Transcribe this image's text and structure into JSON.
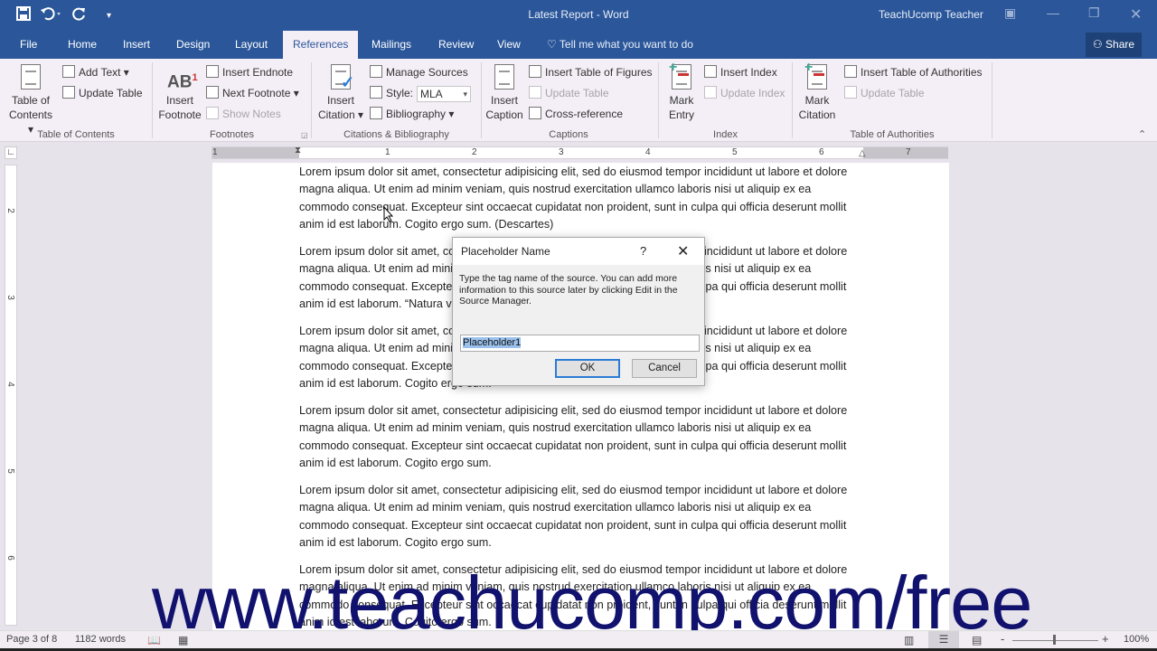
{
  "window": {
    "title": "Latest Report - Word",
    "user": "TeachUcomp Teacher",
    "qat": {
      "save_icon": "save-icon",
      "undo_icon": "undo-icon",
      "redo_icon": "redo-icon",
      "customize_icon": "customize-qat-icon"
    }
  },
  "tabs": [
    "File",
    "Home",
    "Insert",
    "Design",
    "Layout",
    "References",
    "Mailings",
    "Review",
    "View"
  ],
  "active_tab": "References",
  "tell_me": "Tell me what you want to do",
  "share_label": "Share",
  "ribbon": {
    "toc": {
      "label": "Table of Contents",
      "big": "Table of Contents",
      "big_l1": "Table of",
      "big_l2": "Contents ▾",
      "add_text": "Add Text ▾",
      "update_table": "Update Table"
    },
    "footnotes": {
      "label": "Footnotes",
      "insert_footnote_l1": "Insert",
      "insert_footnote_l2": "Footnote",
      "insert_endnote": "Insert Endnote",
      "next_footnote": "Next Footnote ▾",
      "show_notes": "Show Notes"
    },
    "citations": {
      "label": "Citations & Bibliography",
      "insert_citation_l1": "Insert",
      "insert_citation_l2": "Citation ▾",
      "manage_sources": "Manage Sources",
      "style_label": "Style:",
      "style_value": "MLA",
      "bibliography": "Bibliography ▾"
    },
    "captions": {
      "label": "Captions",
      "insert_caption_l1": "Insert",
      "insert_caption_l2": "Caption",
      "insert_table_of_figures": "Insert Table of Figures",
      "update_table": "Update Table",
      "cross_reference": "Cross-reference"
    },
    "index": {
      "label": "Index",
      "mark_entry_l1": "Mark",
      "mark_entry_l2": "Entry",
      "insert_index": "Insert Index",
      "update_index": "Update Index"
    },
    "toa": {
      "label": "Table of Authorities",
      "mark_citation_l1": "Mark",
      "mark_citation_l2": "Citation",
      "insert_toa": "Insert Table of Authorities",
      "update_table": "Update Table"
    }
  },
  "ruler": {
    "h_numbers": [
      "1",
      "1",
      "2",
      "3",
      "4",
      "5",
      "6",
      "7"
    ],
    "v_numbers": [
      "2",
      "3",
      "4",
      "5",
      "6"
    ]
  },
  "document": {
    "paragraphs": [
      "Lorem ipsum dolor sit amet, consectetur adipisicing elit, sed do eiusmod tempor incididunt ut labore et dolore magna aliqua. Ut enim ad minim veniam, quis nostrud exercitation ullamco laboris nisi ut aliquip ex ea commodo consequat. Excepteur sint occaecat cupidatat non proident, sunt in culpa qui officia deserunt mollit anim id est laborum. Cogito ergo sum. (Descartes)",
      "Lorem ipsum dolor sit amet, consectetur adipisicing elit, sed do eiusmod tempor incididunt ut labore et dolore magna aliqua. Ut enim ad minim veniam, quis nostrud exercitation ullamco laboris nisi ut aliquip ex ea commodo consequat. Excepteur sint occaecat cupidatat non proident, sunt in culpa qui officia deserunt mollit anim id est laborum. “Natura vacuum ... ram abhorrere...”",
      "Lorem ipsum dolor sit amet, consectetur adipisicing elit, sed do eiusmod tempor incididunt ut labore et dolore magna aliqua. Ut enim ad minim veniam, quis nostrud exercitation ullamco laboris nisi ut aliquip ex ea commodo consequat. Excepteur sint occaecat cupidatat non proident, sunt in culpa qui officia deserunt mollit anim id est laborum. Cogito ergo sum.",
      "Lorem ipsum dolor sit amet, consectetur adipisicing elit, sed do eiusmod tempor incididunt ut labore et dolore magna aliqua. Ut enim ad minim veniam, quis nostrud exercitation ullamco laboris nisi ut aliquip ex ea commodo consequat. Excepteur sint occaecat cupidatat non proident, sunt in culpa qui officia deserunt mollit anim id est laborum. Cogito ergo sum.",
      "Lorem ipsum dolor sit amet, consectetur adipisicing elit, sed do eiusmod tempor incididunt ut labore et dolore magna aliqua. Ut enim ad minim veniam, quis nostrud exercitation ullamco laboris nisi ut aliquip ex ea commodo consequat. Excepteur sint occaecat cupidatat non proident, sunt in culpa qui officia deserunt mollit anim id est laborum. Cogito ergo sum.",
      "Lorem ipsum dolor sit amet, consectetur adipisicing elit, sed do eiusmod tempor incididunt ut labore et dolore magna aliqua. Ut enim ad minim veniam, quis nostrud exercitation ullamco laboris nisi ut aliquip ex ea commodo consequat. Excepteur sint occaecat cupidatat non proident, sunt in culpa qui officia deserunt mollit anim id est laborum. Cogito ergo sum."
    ]
  },
  "dialog": {
    "title": "Placeholder Name",
    "help": "?",
    "message": "Type the tag name of the source. You can add more information to this source later by clicking Edit in the Source Manager.",
    "input_value": "Placeholder1",
    "ok_label": "OK",
    "cancel_label": "Cancel"
  },
  "watermark": "www.teachucomp.com/free",
  "status": {
    "page": "Page 3 of 8",
    "words": "1182 words",
    "zoom": "100%",
    "zoom_minus": "-",
    "zoom_plus": "+"
  },
  "colors": {
    "brand": "#2b579a",
    "ribbon_bg": "#f4eef6",
    "watermark": "#11116e",
    "ok_border": "#2b7bd5"
  }
}
